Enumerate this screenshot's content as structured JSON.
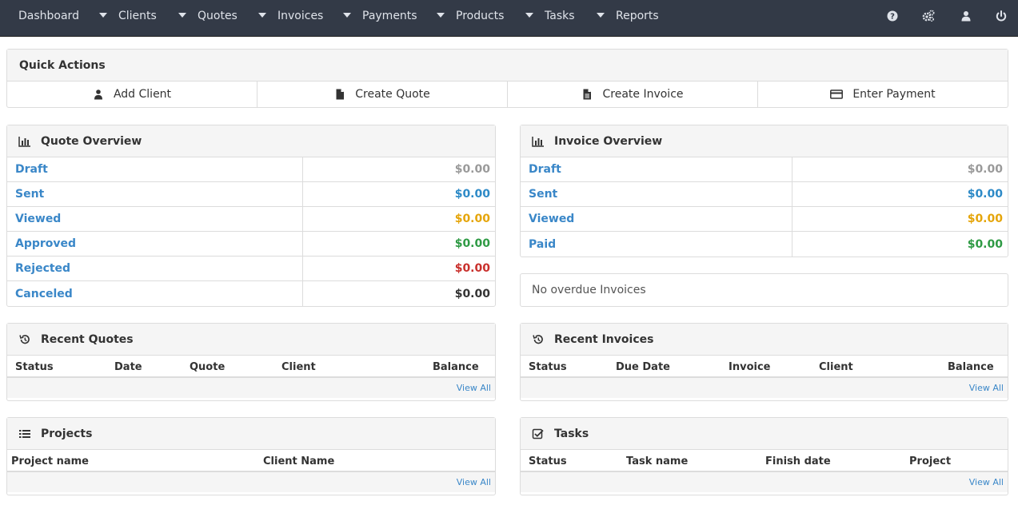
{
  "nav": {
    "items": [
      {
        "label": "Dashboard",
        "dropdown": false
      },
      {
        "label": "Clients",
        "dropdown": true
      },
      {
        "label": "Quotes",
        "dropdown": true
      },
      {
        "label": "Invoices",
        "dropdown": true
      },
      {
        "label": "Payments",
        "dropdown": true
      },
      {
        "label": "Products",
        "dropdown": true
      },
      {
        "label": "Tasks",
        "dropdown": true
      },
      {
        "label": "Reports",
        "dropdown": true
      }
    ],
    "right_icons": [
      "help-icon",
      "settings-cogs-icon",
      "user-icon",
      "power-icon"
    ]
  },
  "quick_actions": {
    "title": "Quick Actions",
    "buttons": [
      {
        "label": "Add Client",
        "icon": "user-icon"
      },
      {
        "label": "Create Quote",
        "icon": "file-icon"
      },
      {
        "label": "Create Invoice",
        "icon": "file-text-icon"
      },
      {
        "label": "Enter Payment",
        "icon": "credit-card-icon"
      }
    ]
  },
  "quote_overview": {
    "title": "Quote Overview",
    "rows": [
      {
        "label": "Draft",
        "value": "$0.00",
        "color": "#9a9a9a"
      },
      {
        "label": "Sent",
        "value": "$0.00",
        "color": "#2d8ac7"
      },
      {
        "label": "Viewed",
        "value": "$0.00",
        "color": "#e5a50a"
      },
      {
        "label": "Approved",
        "value": "$0.00",
        "color": "#2e9a44"
      },
      {
        "label": "Rejected",
        "value": "$0.00",
        "color": "#c9302c"
      },
      {
        "label": "Canceled",
        "value": "$0.00",
        "color": "#333333"
      }
    ]
  },
  "invoice_overview": {
    "title": "Invoice Overview",
    "rows": [
      {
        "label": "Draft",
        "value": "$0.00",
        "color": "#9a9a9a"
      },
      {
        "label": "Sent",
        "value": "$0.00",
        "color": "#2d8ac7"
      },
      {
        "label": "Viewed",
        "value": "$0.00",
        "color": "#e5a50a"
      },
      {
        "label": "Paid",
        "value": "$0.00",
        "color": "#2e9a44"
      }
    ],
    "overdue_text": "No overdue Invoices"
  },
  "recent_quotes": {
    "title": "Recent Quotes",
    "columns": [
      "Status",
      "Date",
      "Quote",
      "Client",
      "Balance"
    ],
    "view_all": "View All"
  },
  "recent_invoices": {
    "title": "Recent Invoices",
    "columns": [
      "Status",
      "Due Date",
      "Invoice",
      "Client",
      "Balance"
    ],
    "view_all": "View All"
  },
  "projects": {
    "title": "Projects",
    "columns": [
      "Project name",
      "Client Name"
    ],
    "view_all": "View All"
  },
  "tasks": {
    "title": "Tasks",
    "columns": [
      "Status",
      "Task name",
      "Finish date",
      "Project"
    ],
    "view_all": "View All"
  }
}
